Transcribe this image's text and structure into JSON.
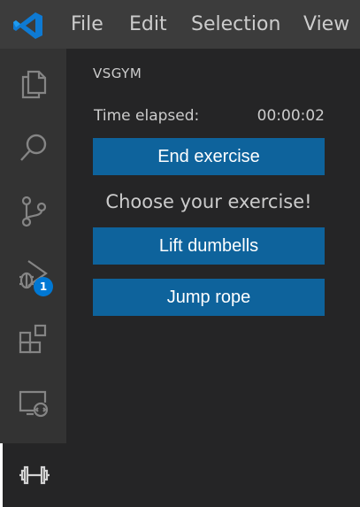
{
  "titlebar": {
    "logo_icon": "vscode-logo",
    "menu": [
      "File",
      "Edit",
      "Selection",
      "View"
    ]
  },
  "activitybar": {
    "items": [
      {
        "icon": "files-icon"
      },
      {
        "icon": "search-icon"
      },
      {
        "icon": "source-control-icon"
      },
      {
        "icon": "run-debug-icon",
        "badge": "1"
      },
      {
        "icon": "extensions-icon"
      },
      {
        "icon": "remote-explorer-icon"
      },
      {
        "icon": "dumbbell-icon",
        "active": true
      }
    ]
  },
  "sidebar": {
    "title": "VSGYM",
    "time_label": "Time elapsed:",
    "time_value": "00:00:02",
    "end_button": "End exercise",
    "choose_text": "Choose your exercise!",
    "exercises": [
      "Lift dumbells",
      "Jump rope"
    ]
  },
  "colors": {
    "titlebar_bg": "#3c3c3c",
    "activitybar_bg": "#333333",
    "sidebar_bg": "#252526",
    "button_bg": "#0e639c",
    "badge_bg": "#0078d4",
    "logo_blue": "#0e7ad3"
  }
}
